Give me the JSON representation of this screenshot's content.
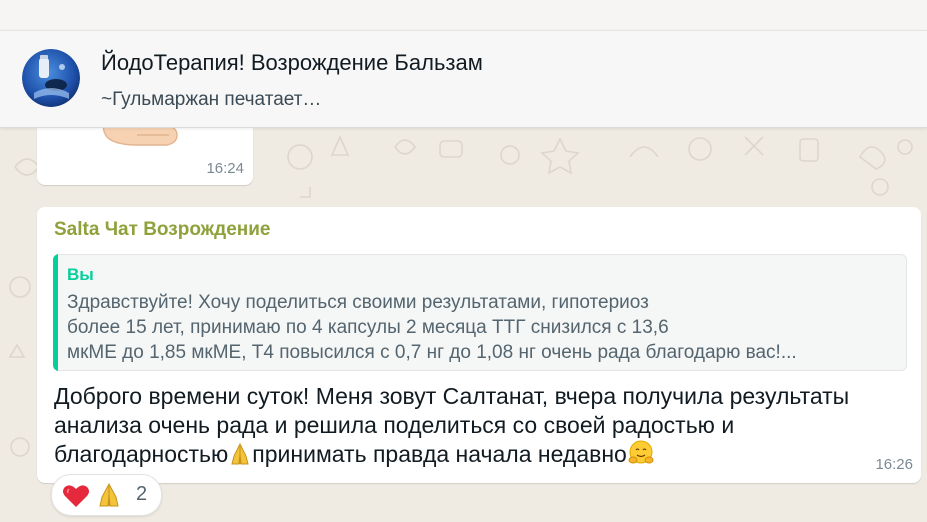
{
  "header": {
    "title": "ЙодоТерапия! Возрождение Бальзам",
    "subtitle": "~Гульмаржан печатает…",
    "avatar_icon": "chat-group-avatar"
  },
  "previous_message": {
    "sticker_icon": "hand-sticker-icon",
    "time": "16:24"
  },
  "message": {
    "sender": "Salta Чат Возрождение",
    "sender_color": "#8ea13a",
    "quote": {
      "author": "Вы",
      "author_color": "#06cf9c",
      "lines": [
        "Здравствуйте! Хочу поделиться своими результатами, гипотериоз",
        "более 15 лет, принимаю по 4 капсулы 2 месяца ТТГ снизился с 13,6",
        "мкМЕ до 1,85 мкМЕ, Т4 повысился с 0,7 нг до 1,08 нг очень рада благодарю вас!..."
      ]
    },
    "text": {
      "line1": "Доброго времени суток! Меня зовут Салтанат, вчера получила результаты",
      "line2": "анализа очень рада и решила поделиться со своей радостью и",
      "line3_a": "благодарностью",
      "line3_b": "принимать правда начала недавно"
    },
    "inline_emojis": [
      "folded-hands-icon",
      "hugging-face-icon"
    ],
    "time": "16:26"
  },
  "reactions": {
    "emojis": [
      "red-heart-icon",
      "folded-hands-icon"
    ],
    "count": "2"
  },
  "colors": {
    "chat_background": "#efeae2",
    "bubble": "#ffffff",
    "quote_accent": "#06cf9c",
    "header_background": "#f7f7f7"
  }
}
